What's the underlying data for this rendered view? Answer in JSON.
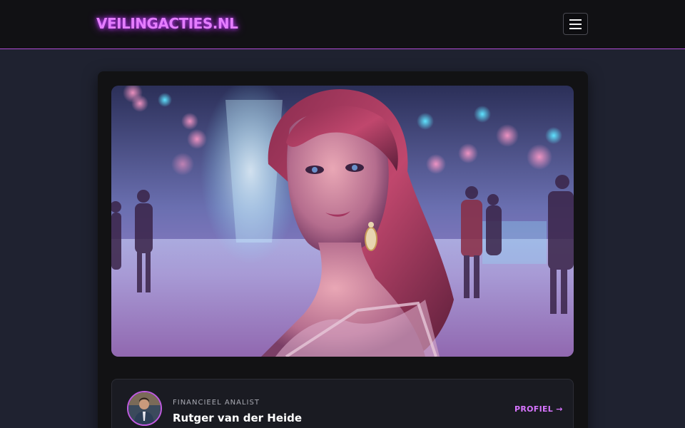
{
  "header": {
    "brand": "VEILINGACTIES.NL",
    "menu_icon": "hamburger-menu-icon"
  },
  "article": {
    "hero_image_alt": "",
    "author": {
      "role": "FINANCIEEL ANALIST",
      "name": "Rutger van der Heide",
      "profile_link": "PROFIEL →"
    }
  },
  "colors": {
    "accent": "#d774ff",
    "background": "#1f2230",
    "header_bg": "#111114",
    "card_bg": "#121214"
  }
}
